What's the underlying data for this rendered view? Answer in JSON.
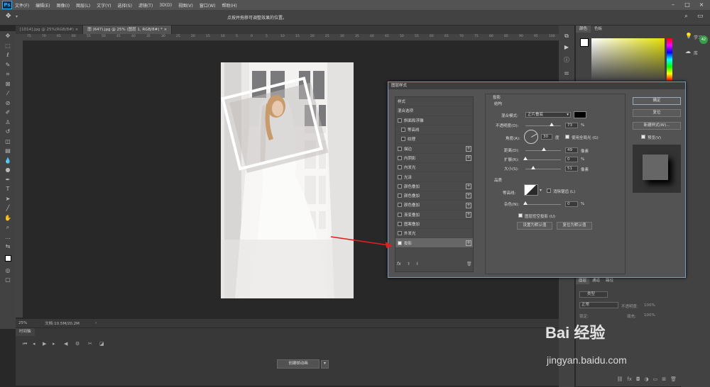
{
  "menubar": {
    "logo": "Ps",
    "items": [
      "文件(F)",
      "编辑(E)",
      "图像(I)",
      "图层(L)",
      "文字(Y)",
      "选择(S)",
      "滤镜(T)",
      "3D(D)",
      "视图(V)",
      "窗口(W)",
      "帮助(H)"
    ]
  },
  "options_bar": {
    "hint": "点按并拖移可调整效果的位置。"
  },
  "tabs": [
    {
      "label": "[1014].jpg @ 25%(RGB/8#)",
      "close": "×"
    },
    {
      "label": "图 (647).jpg @ 25% (图层 1, RGB/8#) *",
      "close": "×"
    }
  ],
  "ruler_ticks": [
    "75",
    "70",
    "65",
    "60",
    "55",
    "50",
    "45",
    "40",
    "35",
    "30",
    "25",
    "20",
    "15",
    "10",
    "5",
    "0",
    "5",
    "10",
    "15",
    "20",
    "25",
    "30",
    "35",
    "40",
    "45",
    "50",
    "55",
    "60",
    "65",
    "70",
    "75",
    "80",
    "85",
    "90",
    "95",
    "100"
  ],
  "status": {
    "zoom": "25%",
    "doc": "文档:10.5M/20.2M"
  },
  "timeline": {
    "tab": "时间轴",
    "create_button": "创建帧动画"
  },
  "color_panel": {
    "tabs": [
      "颜色",
      "色板"
    ]
  },
  "learn": {
    "label": "学习",
    "lib": "库"
  },
  "layers_panel": {
    "tabs": [
      "图层",
      "通道",
      "路径"
    ],
    "filter": "类型",
    "blend": "正常",
    "opacity_label": "不透明度:",
    "opacity": "100%",
    "lock_label": "锁定:",
    "fill_label": "填充:",
    "fill": "100%"
  },
  "watermark": {
    "brand": "Bai 经验",
    "url": "jingyan.baidu.com"
  },
  "dialog": {
    "title": "图层样式",
    "styles_header": "样式",
    "blend_options": "混合选项",
    "items": [
      {
        "label": "斜面和浮雕",
        "checked": false,
        "plus": false,
        "indent": false
      },
      {
        "label": "等高线",
        "checked": false,
        "plus": false,
        "indent": true
      },
      {
        "label": "纹理",
        "checked": false,
        "plus": false,
        "indent": true
      },
      {
        "label": "描边",
        "checked": false,
        "plus": true,
        "indent": false
      },
      {
        "label": "内阴影",
        "checked": false,
        "plus": true,
        "indent": false
      },
      {
        "label": "内发光",
        "checked": false,
        "plus": false,
        "indent": false
      },
      {
        "label": "光泽",
        "checked": false,
        "plus": false,
        "indent": false
      },
      {
        "label": "颜色叠加",
        "checked": false,
        "plus": true,
        "indent": false
      },
      {
        "label": "颜色叠加",
        "checked": false,
        "plus": true,
        "indent": false
      },
      {
        "label": "颜色叠加",
        "checked": false,
        "plus": true,
        "indent": false
      },
      {
        "label": "渐变叠加",
        "checked": false,
        "plus": true,
        "indent": false
      },
      {
        "label": "图案叠加",
        "checked": false,
        "plus": false,
        "indent": false
      },
      {
        "label": "外发光",
        "checked": false,
        "plus": false,
        "indent": false
      },
      {
        "label": "投影",
        "checked": true,
        "plus": true,
        "indent": false
      }
    ],
    "fx": "fx",
    "section": "投影",
    "structure": "结构",
    "blend_mode_label": "混合模式:",
    "blend_mode": "正片叠底",
    "opacity_label": "不透明度(O):",
    "opacity": "73",
    "opacity_frac": 0.73,
    "pct": "%",
    "angle_label": "角度(A):",
    "angle": "30",
    "deg": "度",
    "global_light": "使用全局光 (G)",
    "distance_label": "距离(D):",
    "distance": "49",
    "px": "像素",
    "spread_label": "扩展(R):",
    "spread": "0",
    "size_label": "大小(S):",
    "size": "51",
    "quality": "品质",
    "contour_label": "等高线:",
    "antialias": "消除锯齿 (L)",
    "noise_label": "杂色(N):",
    "noise": "0",
    "knockout": "图层挖空投影 (U)",
    "set_default": "设置为默认值",
    "reset_default": "复位为默认值",
    "ok": "确定",
    "reset": "复位",
    "new_style": "新建样式(W)...",
    "preview": "预览(V)"
  }
}
